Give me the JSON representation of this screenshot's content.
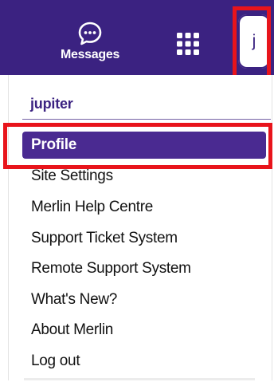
{
  "header": {
    "messages_label": "Messages",
    "messages_icon": "chat-bubble-icon",
    "apps_icon": "grid-apps-icon",
    "avatar_initial": "j",
    "accent_color": "#3b2281"
  },
  "menu": {
    "username": "jupiter",
    "items": [
      {
        "label": "Profile",
        "active": true
      },
      {
        "label": "Site Settings",
        "active": false
      },
      {
        "label": "Merlin Help Centre",
        "active": false
      },
      {
        "label": "Support Ticket System",
        "active": false
      },
      {
        "label": "Remote Support System",
        "active": false
      },
      {
        "label": "What's New?",
        "active": false
      },
      {
        "label": "About Merlin",
        "active": false
      },
      {
        "label": "Log out",
        "active": false
      }
    ]
  },
  "highlight_color": "#e8141b"
}
